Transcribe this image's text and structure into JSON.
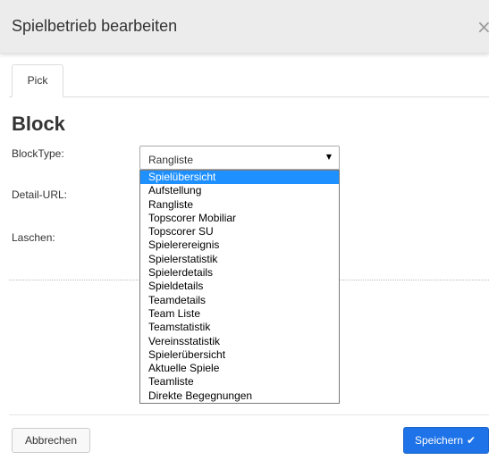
{
  "modal": {
    "title": "Spielbetrieb bearbeiten",
    "close_glyph": "×"
  },
  "tabs": [
    {
      "label": "Pick"
    }
  ],
  "form": {
    "heading": "Block",
    "blocktype_label": "BlockType:",
    "detail_url_label": "Detail-URL:",
    "laschen_label": "Laschen:",
    "blocktype_value": "Rangliste",
    "arrow_glyph": "▼"
  },
  "dropdown": {
    "highlighted_index": 0,
    "options": [
      "Spielübersicht",
      "Aufstellung",
      "Rangliste",
      "Topscorer Mobiliar",
      "Topscorer SU",
      "Spielerereignis",
      "Spielerstatistik",
      "Spielerdetails",
      "Spieldetails",
      "Teamdetails",
      "Team Liste",
      "Teamstatistik",
      "Vereinsstatistik",
      "Spielerübersicht",
      "Aktuelle Spiele",
      "Teamliste",
      "Direkte Begegnungen"
    ]
  },
  "footer": {
    "cancel_label": "Abbrechen",
    "save_label": "Speichern",
    "save_icon_glyph": "✔"
  },
  "colors": {
    "accent": "#1e73e8",
    "highlight": "#1e90ff",
    "header_bg": "#ececec"
  }
}
